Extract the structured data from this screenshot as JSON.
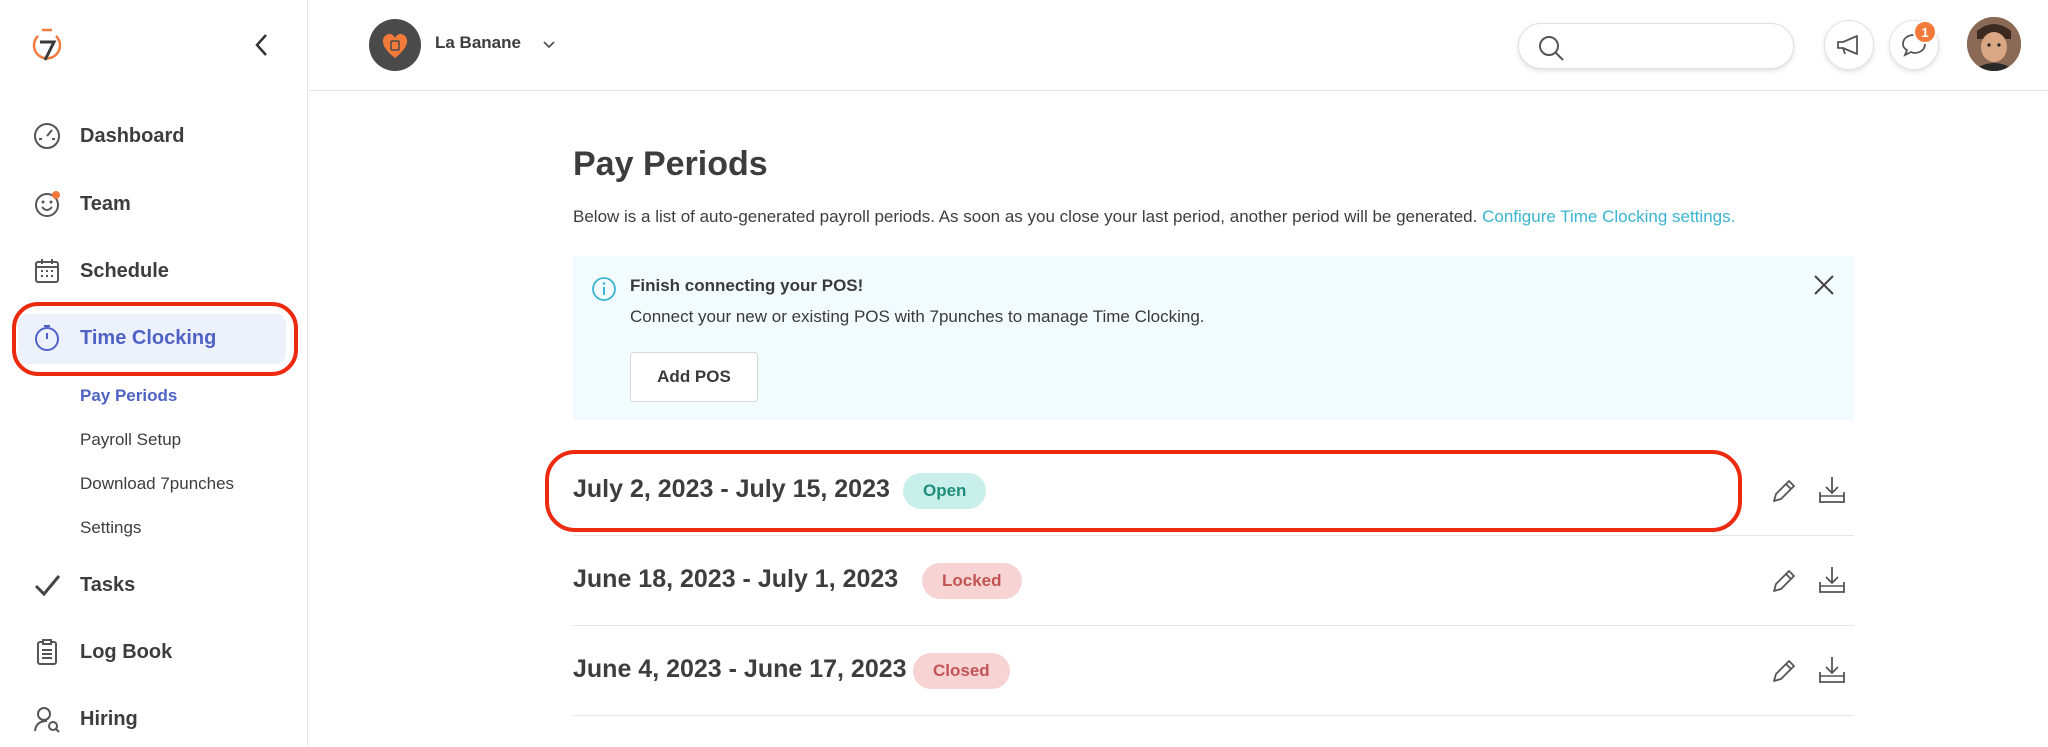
{
  "sidebar": {
    "items": [
      {
        "label": "Dashboard",
        "icon": "gauge-icon"
      },
      {
        "label": "Team",
        "icon": "smiley-icon"
      },
      {
        "label": "Schedule",
        "icon": "calendar-icon"
      },
      {
        "label": "Time Clocking",
        "icon": "stopwatch-icon",
        "active": true
      },
      {
        "label": "Tasks",
        "icon": "check-icon"
      },
      {
        "label": "Log Book",
        "icon": "clipboard-icon"
      },
      {
        "label": "Hiring",
        "icon": "person-search-icon"
      }
    ],
    "sub_items": [
      "Pay Periods",
      "Payroll Setup",
      "Download 7punches",
      "Settings"
    ],
    "active_sub": "Pay Periods"
  },
  "header": {
    "org_name": "La Banane",
    "notification_count": "1"
  },
  "main": {
    "title": "Pay Periods",
    "description": "Below is a list of auto-generated payroll periods. As soon as you close your last period, another period will be generated.",
    "configure_link": "Configure Time Clocking settings.",
    "banner": {
      "title": "Finish connecting your POS!",
      "text": "Connect your new or existing POS with 7punches to manage Time Clocking.",
      "button": "Add POS"
    },
    "periods": [
      {
        "label": "July 2, 2023 - July 15, 2023",
        "status": "Open"
      },
      {
        "label": "June 18, 2023 - July 1, 2023",
        "status": "Locked"
      },
      {
        "label": "June 4, 2023 - June 17, 2023",
        "status": "Closed"
      }
    ]
  },
  "colors": {
    "accent": "#4f63c4",
    "brand": "#f47a3c",
    "link": "#3ab4d2",
    "highlight": "#ec2a10"
  }
}
